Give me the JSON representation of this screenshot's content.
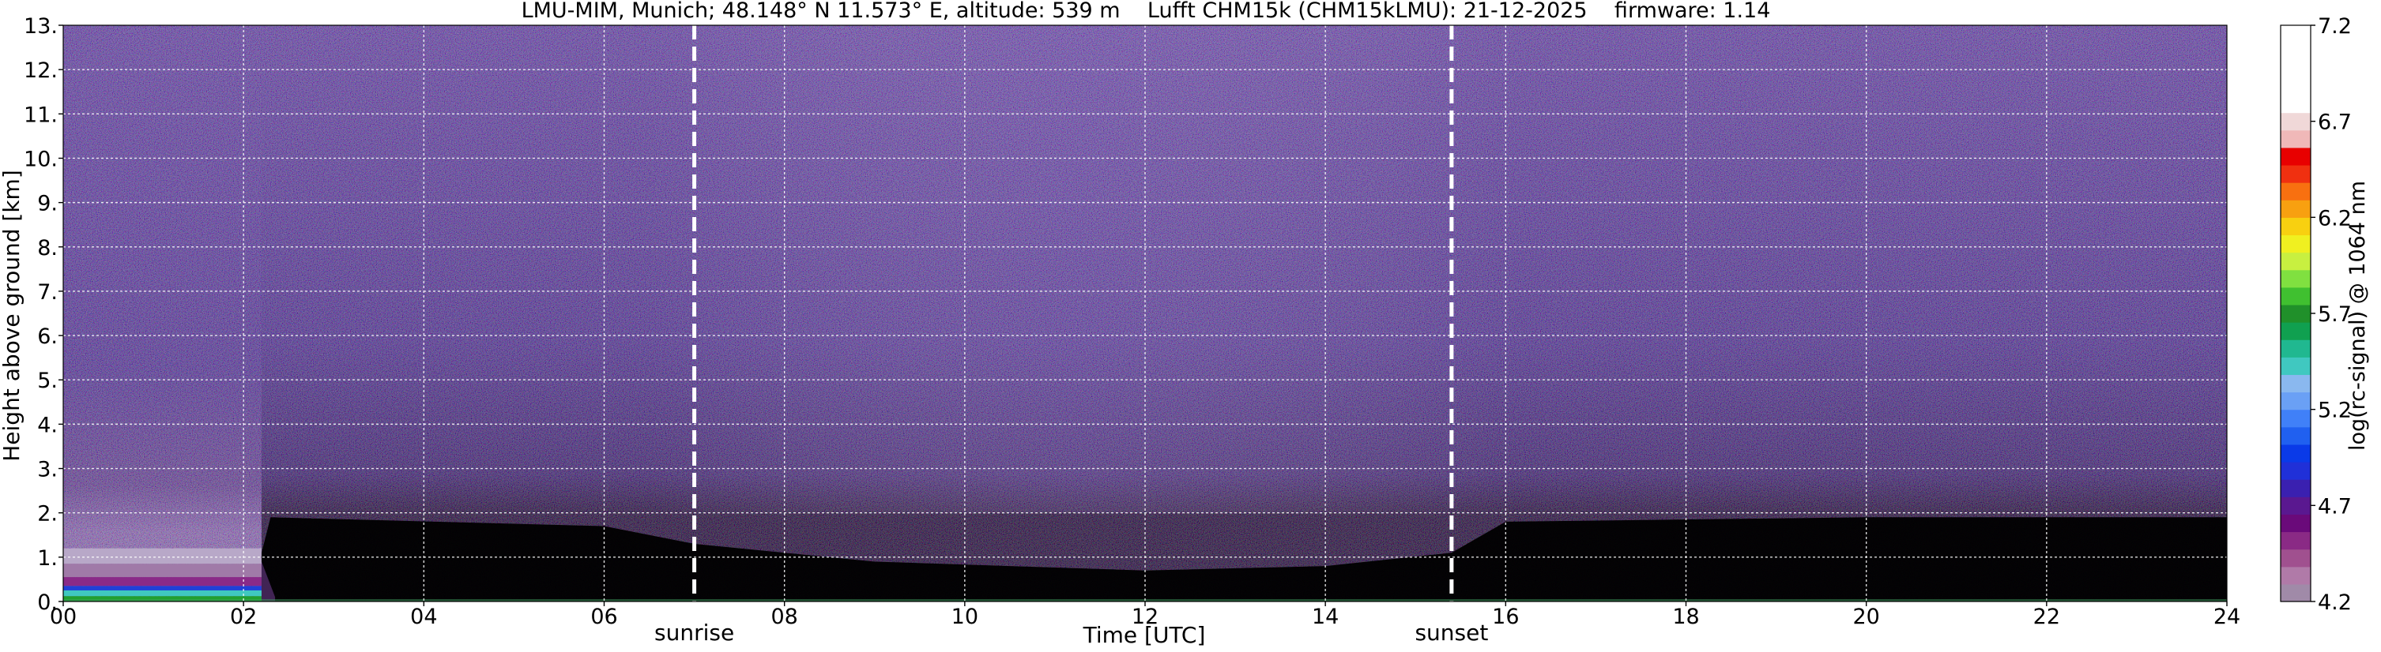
{
  "chart_data": {
    "type": "heatmap",
    "title": "LMU-MIM, Munich; 48.148° N 11.573° E, altitude: 539 m    Lufft CHM15k (CHM15kLMU): 21-12-2025    firmware: 1.14",
    "xlabel": "Time [UTC]",
    "ylabel": "Height above ground [km]",
    "xlim": [
      0,
      24
    ],
    "ylim": [
      0,
      13
    ],
    "x_ticks": [
      "00",
      "02",
      "04",
      "06",
      "08",
      "10",
      "12",
      "14",
      "16",
      "18",
      "20",
      "22",
      "24"
    ],
    "y_ticks": [
      "0.",
      "1.",
      "2.",
      "3.",
      "4.",
      "5.",
      "6.",
      "7.",
      "8.",
      "9.",
      "10.",
      "11.",
      "12.",
      "13."
    ],
    "grid": true,
    "events": [
      {
        "label": "sunrise",
        "time": 7.0
      },
      {
        "label": "sunset",
        "time": 15.4
      }
    ],
    "colorbar": {
      "label": "log(rc-signal) @ 1064 nm",
      "range": [
        4.2,
        7.2
      ],
      "ticks": [
        "4.2",
        "4.7",
        "5.2",
        "5.7",
        "6.2",
        "6.7",
        "7.2"
      ],
      "colors": [
        "#a08aa8",
        "#b07aa8",
        "#a0508f",
        "#8a2a85",
        "#6a0a7a",
        "#5a1890",
        "#3a20b0",
        "#2030d8",
        "#0a3ae8",
        "#2060f0",
        "#4080f8",
        "#6aa0f5",
        "#8ab8ef",
        "#40c8c0",
        "#20b890",
        "#10a050",
        "#20902a",
        "#40c030",
        "#80e040",
        "#c8f040",
        "#f0f020",
        "#f8d010",
        "#f8a010",
        "#f87010",
        "#f03010",
        "#e80000",
        "#f0b8b8",
        "#f0d8d8",
        "#ffffff",
        "#ffffff",
        "#ffffff",
        "#ffffff",
        "#ffffff"
      ]
    },
    "background_regime": [
      {
        "x": [
          0,
          2.2
        ],
        "description_color": "#5a4a8a"
      },
      {
        "x": [
          2.2,
          24
        ],
        "description_color": "#4a3a80"
      }
    ],
    "aerosol_layer": {
      "x": [
        0,
        2.2
      ],
      "y": [
        0,
        1.2
      ]
    },
    "noise_floor_height_km": [
      {
        "x": 0,
        "y": 2.0
      },
      {
        "x": 2.2,
        "y": 2.0
      },
      {
        "x": 2.3,
        "y": 2.8
      },
      {
        "x": 6,
        "y": 2.6
      },
      {
        "x": 7,
        "y": 2.2
      },
      {
        "x": 9,
        "y": 1.8
      },
      {
        "x": 12,
        "y": 1.6
      },
      {
        "x": 14,
        "y": 1.7
      },
      {
        "x": 15.4,
        "y": 2.0
      },
      {
        "x": 16,
        "y": 2.7
      },
      {
        "x": 20,
        "y": 2.8
      },
      {
        "x": 24,
        "y": 2.8
      }
    ]
  }
}
